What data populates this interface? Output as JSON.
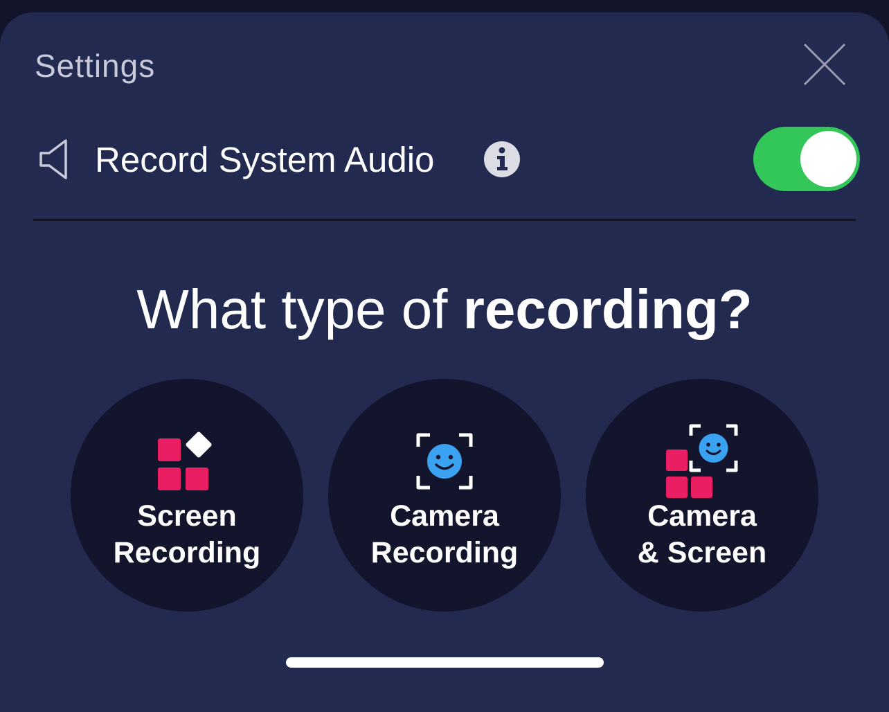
{
  "header": {
    "title": "Settings"
  },
  "audio_setting": {
    "label": "Record System Audio",
    "enabled": true
  },
  "question": {
    "prefix": "What type of ",
    "emphasis": "recording?"
  },
  "options": [
    {
      "line1": "Screen",
      "line2": "Recording",
      "icon": "screen-recording-icon"
    },
    {
      "line1": "Camera",
      "line2": "Recording",
      "icon": "camera-face-icon"
    },
    {
      "line1": "Camera",
      "line2": "& Screen",
      "icon": "camera-and-screen-icon"
    }
  ],
  "colors": {
    "background": "#222a4f",
    "option_circle": "#12152b",
    "toggle_on": "#33c759",
    "pink": "#e91e63",
    "face_blue": "#3ba1f1"
  }
}
